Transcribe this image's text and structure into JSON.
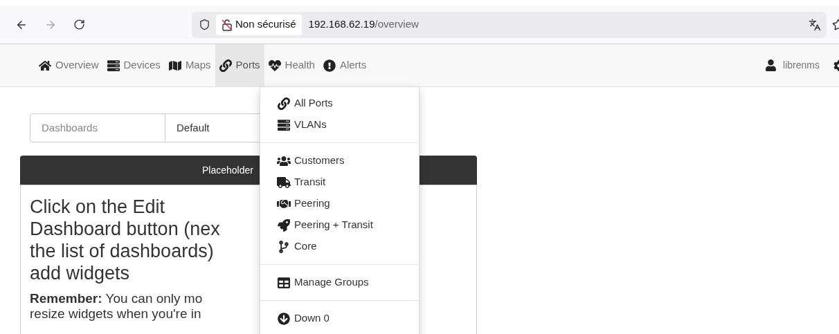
{
  "browser": {
    "security": "Non sécurisé",
    "url_host": "192.168.62.19",
    "url_path": "/overview"
  },
  "navbar": {
    "items": [
      {
        "label": "Overview",
        "kind": "home",
        "selected": false
      },
      {
        "label": "Devices",
        "kind": "server",
        "selected": false
      },
      {
        "label": "Maps",
        "kind": "map",
        "selected": false
      },
      {
        "label": "Ports",
        "kind": "link",
        "selected": true
      },
      {
        "label": "Health",
        "kind": "heart",
        "selected": false
      },
      {
        "label": "Alerts",
        "kind": "alert",
        "selected": false
      }
    ],
    "user": "librenms"
  },
  "dashboard_selector": {
    "label": "Dashboards",
    "value": "Default"
  },
  "widget": {
    "title": "Placeholder",
    "heading_lines": [
      "Click on the Edit",
      "Dashboard button (nex",
      "the list of dashboards)",
      "add widgets"
    ],
    "note_lines": [
      "**Remember:** You can only mo",
      "resize widgets when you're in"
    ]
  },
  "ports_menu": {
    "groups": [
      [
        {
          "label": "All Ports",
          "kind": "link"
        },
        {
          "label": "VLANs",
          "kind": "server"
        }
      ],
      [
        {
          "label": "Customers",
          "kind": "users"
        },
        {
          "label": "Transit",
          "kind": "truck"
        },
        {
          "label": "Peering",
          "kind": "handshake"
        },
        {
          "label": "Peering + Transit",
          "kind": "rocket"
        },
        {
          "label": "Core",
          "kind": "branch"
        }
      ],
      [
        {
          "label": "Manage Groups",
          "kind": "table"
        }
      ],
      [
        {
          "label": "Down 0",
          "kind": "down"
        }
      ]
    ]
  }
}
